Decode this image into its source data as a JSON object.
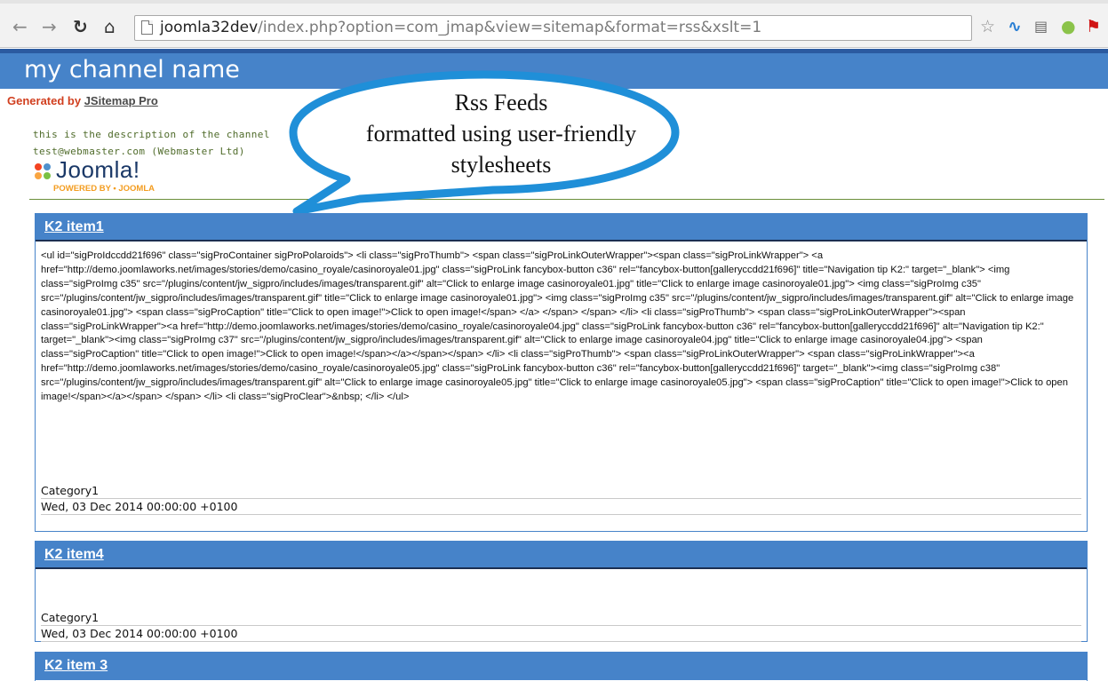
{
  "browser": {
    "url_host": "joomla32dev",
    "url_rest": "/index.php?option=com_jmap&view=sitemap&format=rss&xslt=1"
  },
  "channel": {
    "title": "my channel name",
    "generated_prefix": "Generated by ",
    "generated_link": "JSitemap Pro",
    "description": "this is the description of the channel",
    "webmaster": "test@webmaster.com (Webmaster Ltd)",
    "logo_word": "Joomla!",
    "logo_powered": "POWERED BY • JOOMLA"
  },
  "callout": {
    "line1": "Rss Feeds",
    "line2": "formatted using user-friendly",
    "line3": "stylesheets"
  },
  "items": [
    {
      "title": "K2 item1",
      "body": "<ul id=\"sigProIdccdd21f696\" class=\"sigProContainer sigProPolaroids\"> <li class=\"sigProThumb\"> <span class=\"sigProLinkOuterWrapper\"><span class=\"sigProLinkWrapper\"> <a href=\"http://demo.joomlaworks.net/images/stories/demo/casino_royale/casinoroyale01.jpg\" class=\"sigProLink fancybox-button c36\" rel=\"fancybox-button[galleryccdd21f696]\" title=\"Navigation tip K2:\" target=\"_blank\"> <img class=\"sigProImg c35\" src=\"/plugins/content/jw_sigpro/includes/images/transparent.gif\" alt=\"Click to enlarge image casinoroyale01.jpg\" title=\"Click to enlarge image casinoroyale01.jpg\"> <img class=\"sigProImg c35\" src=\"/plugins/content/jw_sigpro/includes/images/transparent.gif\" title=\"Click to enlarge image casinoroyale01.jpg\"> <img class=\"sigProImg c35\" src=\"/plugins/content/jw_sigpro/includes/images/transparent.gif\" alt=\"Click to enlarge image casinoroyale01.jpg\"> <span class=\"sigProCaption\" title=\"Click to open image!\">Click to open image!</span> </a> </span> </span> </li> <li class=\"sigProThumb\"> <span class=\"sigProLinkOuterWrapper\"><span class=\"sigProLinkWrapper\"><a href=\"http://demo.joomlaworks.net/images/stories/demo/casino_royale/casinoroyale04.jpg\" class=\"sigProLink fancybox-button c36\" rel=\"fancybox-button[galleryccdd21f696]\" alt=\"Navigation tip K2:\" target=\"_blank\"><img class=\"sigProImg c37\" src=\"/plugins/content/jw_sigpro/includes/images/transparent.gif\" alt=\"Click to enlarge image casinoroyale04.jpg\" title=\"Click to enlarge image casinoroyale04.jpg\"> <span class=\"sigProCaption\" title=\"Click to open image!\">Click to open image!</span></a></span></span> </li> <li class=\"sigProThumb\"> <span class=\"sigProLinkOuterWrapper\"> <span class=\"sigProLinkWrapper\"><a href=\"http://demo.joomlaworks.net/images/stories/demo/casino_royale/casinoroyale05.jpg\" class=\"sigProLink fancybox-button c36\" rel=\"fancybox-button[galleryccdd21f696]\" target=\"_blank\"><img class=\"sigProImg c38\" src=\"/plugins/content/jw_sigpro/includes/images/transparent.gif\" alt=\"Click to enlarge image casinoroyale05.jpg\" title=\"Click to enlarge image casinoroyale05.jpg\"> <span class=\"sigProCaption\" title=\"Click to open image!\">Click to open image!</span></a></span> </span> </li> <li class=\"sigProClear\">&nbsp; </li> </ul>",
      "category": "Category1",
      "date": "Wed, 03 Dec 2014 00:00:00 +0100"
    },
    {
      "title": "K2 item4",
      "body": "",
      "category": "Category1",
      "date": "Wed, 03 Dec 2014 00:00:00 +0100"
    },
    {
      "title": "K2 item 3"
    }
  ],
  "colors": {
    "header_blue": "#4683c9",
    "header_dark": "#2b5aa0",
    "generated_red": "#d13f1f",
    "desc_green": "#4f6b2a",
    "callout_blue": "#1f8fd8"
  }
}
